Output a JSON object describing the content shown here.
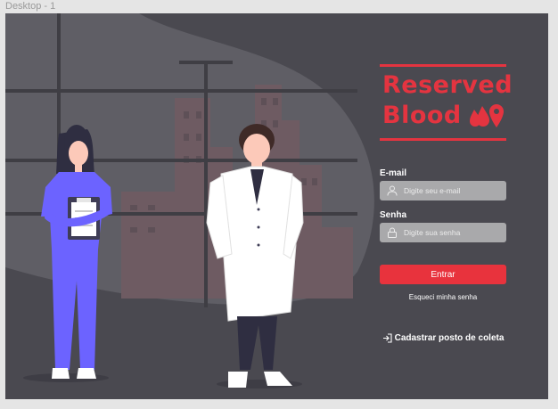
{
  "frame": {
    "label": "Desktop - 1"
  },
  "logo": {
    "line1": "Reserved",
    "line2": "Blood"
  },
  "form": {
    "email_label": "E-mail",
    "email_placeholder": "Digite seu e-mail",
    "password_label": "Senha",
    "password_placeholder": "Digite sua senha",
    "submit_label": "Entrar",
    "forgot_label": "Esqueci minha senha",
    "register_label": "Cadastrar posto de coleta"
  },
  "colors": {
    "background": "#4a4950",
    "accent": "#e43440",
    "input_bg": "#a9a9ab"
  },
  "icons": [
    "drop-icon",
    "map-pin-icon",
    "user-icon",
    "lock-icon",
    "login-arrow-icon"
  ]
}
